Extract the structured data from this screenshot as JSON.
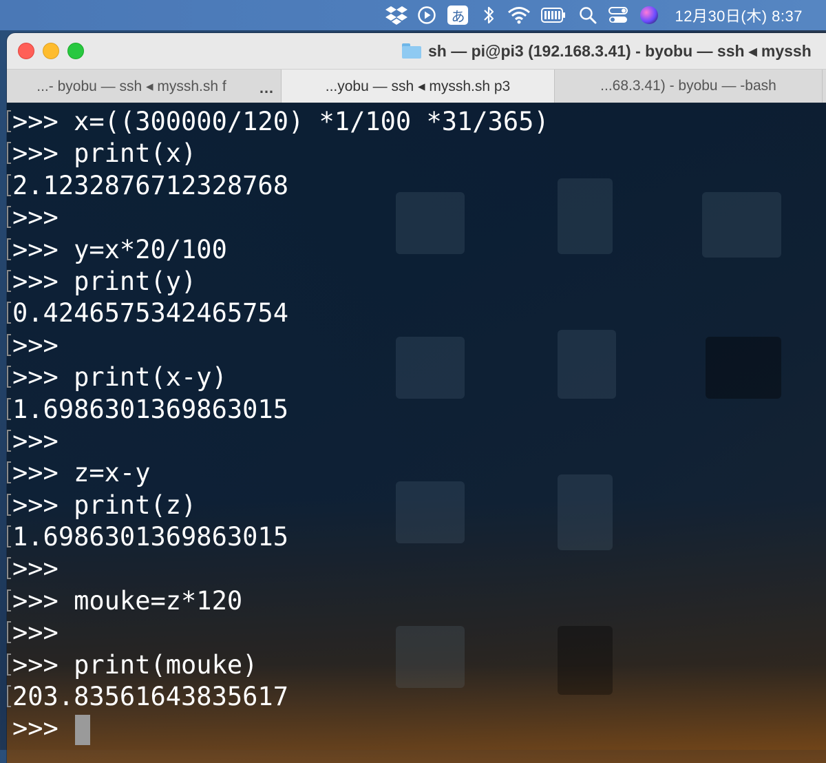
{
  "menubar": {
    "icons": [
      "dropbox-icon",
      "play-icon",
      "ime-icon",
      "bluetooth-icon",
      "wifi-icon",
      "battery-icon",
      "search-icon",
      "control-center-icon",
      "siri-icon"
    ],
    "ime_label": "あ",
    "clock": "12月30日(木)  8:37"
  },
  "window": {
    "title": "sh — pi@pi3 (192.168.3.41) - byobu — ssh ◂ myssh"
  },
  "tabs": [
    {
      "label": "...- byobu — ssh ◂ myssh.sh f",
      "active": false,
      "has_dots": true
    },
    {
      "label": "...yobu — ssh ◂ myssh.sh p3",
      "active": true,
      "has_dots": false
    },
    {
      "label": "...68.3.41) - byobu — -bash",
      "active": false,
      "has_dots": false
    }
  ],
  "terminal": {
    "lines": [
      ">>> x=((300000/120) *1/100 *31/365)",
      ">>> print(x)",
      "2.1232876712328768",
      ">>>",
      ">>> y=x*20/100",
      ">>> print(y)",
      "0.4246575342465754",
      ">>>",
      ">>> print(x-y)",
      "1.6986301369863015",
      ">>>",
      ">>> z=x-y",
      ">>> print(z)",
      "1.6986301369863015",
      ">>>",
      ">>> mouke=z*120",
      ">>>",
      ">>> print(mouke)",
      "203.83561643835617"
    ],
    "prompt": ">>> "
  }
}
